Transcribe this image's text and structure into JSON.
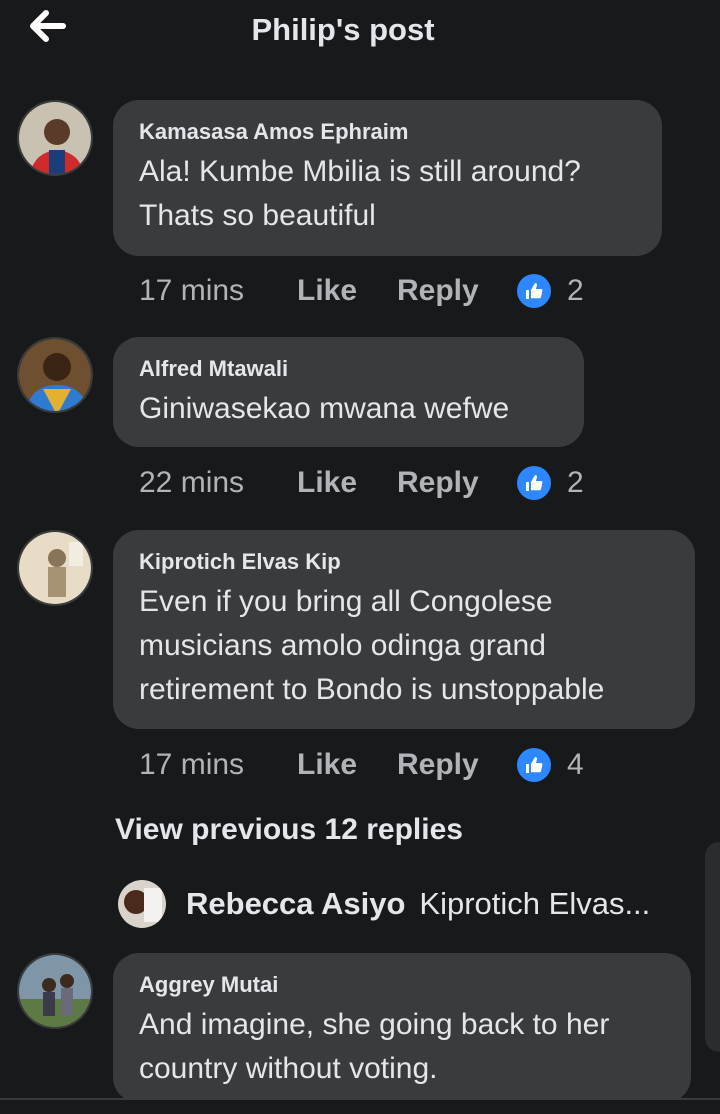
{
  "header": {
    "title": "Philip's post",
    "back_icon": "arrow-left-icon"
  },
  "comments": [
    {
      "author": "Kamasasa Amos Ephraim",
      "text": "Ala! Kumbe Mbilia is still around?\nThats so beautiful",
      "time": "17 mins",
      "like": "Like",
      "reply": "Reply",
      "reactions": "2"
    },
    {
      "author": "Alfred Mtawali",
      "text": "Giniwasekao mwana wefwe",
      "time": "22 mins",
      "like": "Like",
      "reply": "Reply",
      "reactions": "2"
    },
    {
      "author": "Kiprotich Elvas Kip",
      "text": "Even if you bring all Congolese\nmusicians amolo odinga grand\nretirement to Bondo is unstoppable",
      "time": "17 mins",
      "like": "Like",
      "reply": "Reply",
      "reactions": "4"
    },
    {
      "author": "Aggrey Mutai",
      "text": "And imagine, she going back to her\ncountry without voting."
    }
  ],
  "view_previous": "View previous 12 replies",
  "reply_preview": {
    "author": "Rebecca Asiyo",
    "text": "Kiprotich Elvas..."
  },
  "colors": {
    "background": "#18191a",
    "bubble": "#3a3b3c",
    "like_blue": "#2d88ff",
    "muted": "#b0b3b8"
  }
}
